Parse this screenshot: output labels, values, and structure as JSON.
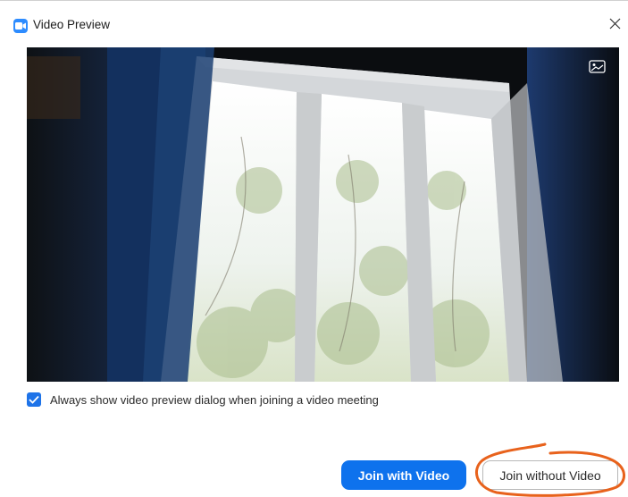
{
  "window": {
    "title": "Video Preview",
    "title_icon": "zoom-camera-icon",
    "close_icon": "close-icon"
  },
  "video_preview": {
    "background_button_icon": "virtual-background-icon"
  },
  "options": {
    "always_show_checked": true,
    "always_show_label": "Always show video preview dialog when joining a video meeting"
  },
  "actions": {
    "join_with_video": "Join with Video",
    "join_without_video": "Join without Video"
  },
  "colors": {
    "primary": "#0e72ed",
    "annotation": "#e8621c"
  }
}
